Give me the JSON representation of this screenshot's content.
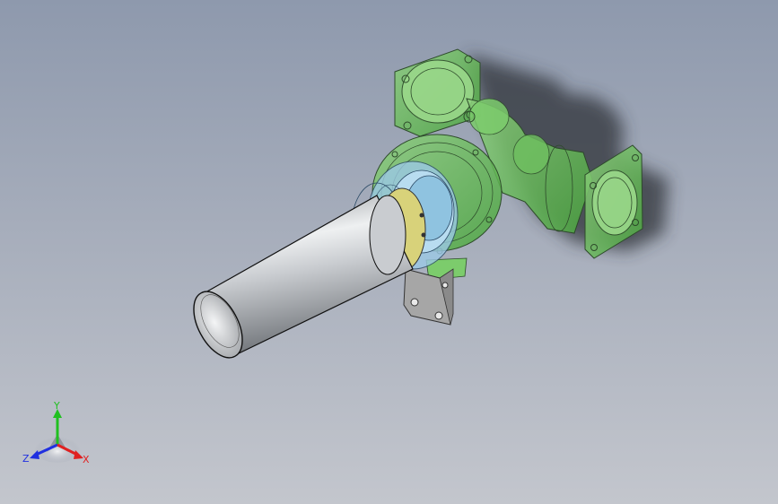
{
  "viewport": {
    "background_top": "#8e99ad",
    "background_bottom": "#c3c6cd"
  },
  "model": {
    "housing_color": "#5fbf52",
    "pipe_color": "#b9bcc0",
    "ring_color": "#d8d27a",
    "seal_color": "#8fc3e0",
    "bracket_color": "#a6a6a6"
  },
  "triad": {
    "x_label": "X",
    "y_label": "Y",
    "z_label": "Z",
    "x_color": "#e02020",
    "y_color": "#20c020",
    "z_color": "#2030e0"
  }
}
